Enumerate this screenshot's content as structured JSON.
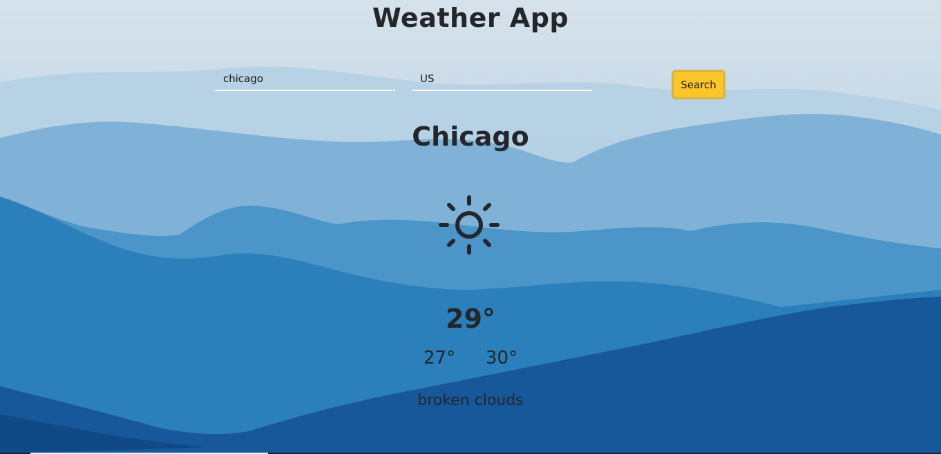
{
  "app": {
    "title": "Weather App"
  },
  "search": {
    "city_value": "chicago",
    "country_value": "US",
    "button_label": "Search"
  },
  "weather": {
    "city": "Chicago",
    "icon": "sun-icon",
    "temperature": "29°",
    "temp_min": "27°",
    "temp_max": "30°",
    "description": "broken clouds"
  },
  "colors": {
    "button": "#fbc62a",
    "text": "#23272b"
  }
}
